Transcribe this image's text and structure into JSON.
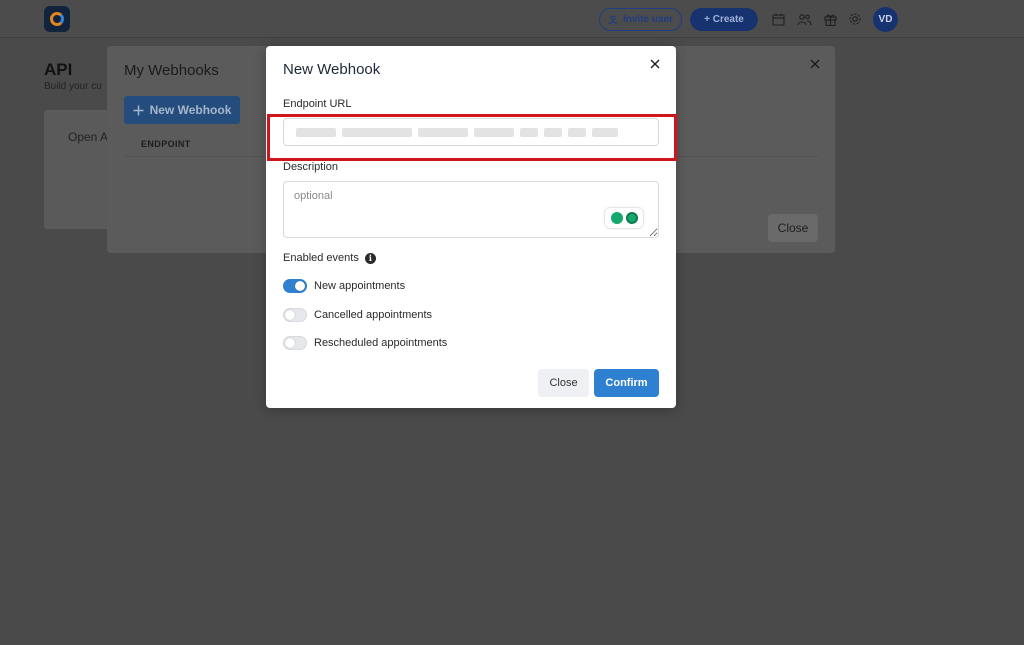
{
  "topbar": {
    "invite_label": "Invite user",
    "create_label": "+ Create",
    "avatar_initials": "VD"
  },
  "page": {
    "title": "API",
    "subtitle": "Build your cu",
    "card_text": "Open A"
  },
  "webhooks_list": {
    "title": "My Webhooks",
    "new_button_label": "New Webhook",
    "column_endpoint": "ENDPOINT",
    "close_label": "Close"
  },
  "new_webhook_modal": {
    "title": "New Webhook",
    "endpoint_label": "Endpoint URL",
    "endpoint_value": "",
    "description_label": "Description",
    "description_placeholder": "optional",
    "events_label": "Enabled events",
    "events": [
      {
        "label": "New appointments",
        "enabled": true
      },
      {
        "label": "Cancelled appointments",
        "enabled": false
      },
      {
        "label": "Rescheduled appointments",
        "enabled": false
      }
    ],
    "close_label": "Close",
    "confirm_label": "Confirm"
  },
  "colors": {
    "accent": "#2f80d1",
    "overlay": "#4a4a4a",
    "highlight": "#d0161c"
  }
}
